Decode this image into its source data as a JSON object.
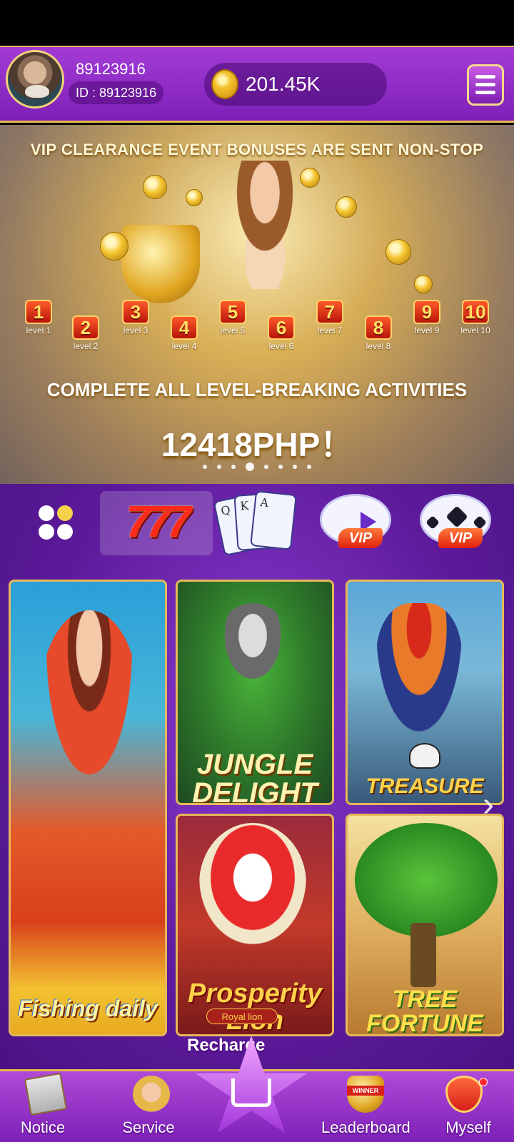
{
  "header": {
    "username": "89123916",
    "user_id": "ID : 89123916",
    "balance": "201.45K"
  },
  "banner": {
    "headline": "VIP CLEARANCE EVENT BONUSES ARE SENT NON-STOP",
    "levels": [
      {
        "num": "1",
        "label": "level 1"
      },
      {
        "num": "2",
        "label": "level 2"
      },
      {
        "num": "3",
        "label": "level 3"
      },
      {
        "num": "4",
        "label": "level 4"
      },
      {
        "num": "5",
        "label": "level 5"
      },
      {
        "num": "6",
        "label": "level 6"
      },
      {
        "num": "7",
        "label": "level 7"
      },
      {
        "num": "8",
        "label": "level 8"
      },
      {
        "num": "9",
        "label": "level 9"
      },
      {
        "num": "10",
        "label": "level 10"
      }
    ],
    "subline": "COMPLETE ALL LEVEL-BREAKING ACTIVITIES",
    "amount": "12418PHP！",
    "carousel_active_index": 3,
    "carousel_count": 8
  },
  "categories": {
    "slots_label": "777",
    "cards_labels": [
      "Q",
      "K",
      "A"
    ],
    "video_vip": "VIP",
    "sport_vip": "VIP"
  },
  "games": {
    "fishing": "Fishing daily",
    "jungle": "JUNGLE DELIGHT",
    "treasure": "TREASURE",
    "lion": "Prosperity Lion",
    "lion_sub": "Royal lion",
    "tree": "TREE FORTUNE"
  },
  "bottom_nav": {
    "notice": "Notice",
    "service": "Service",
    "recharge": "Recharge",
    "leaderboard": "Leaderboard",
    "winner_tag": "WINNER",
    "myself": "Myself"
  },
  "colors": {
    "accent_purple": "#7d20b8",
    "gold_border": "#e7b84a"
  }
}
